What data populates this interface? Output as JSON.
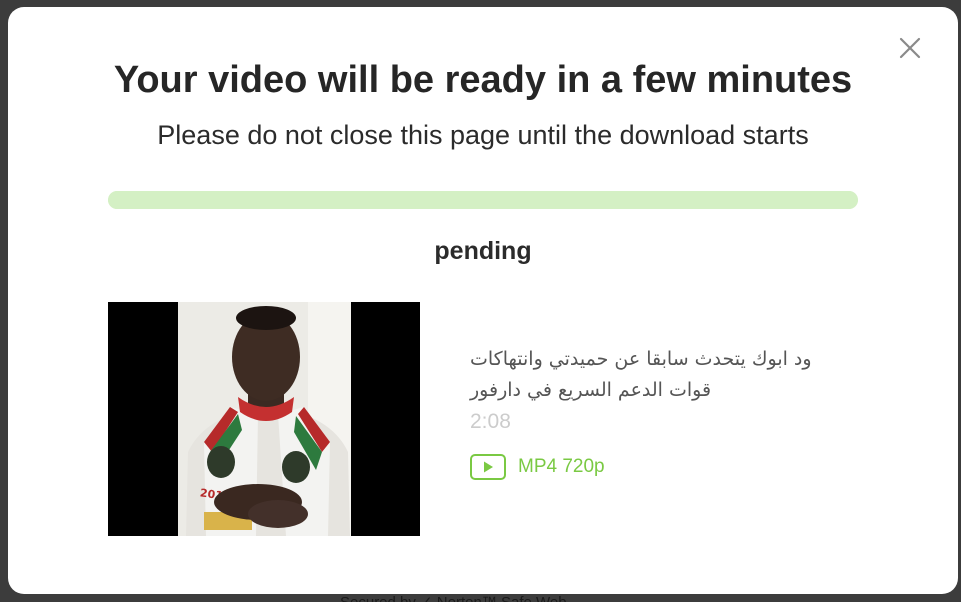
{
  "modal": {
    "title": "Your video will be ready in a few minutes",
    "subtitle": "Please do not close this page until the download starts",
    "progress": 1.0,
    "progress_color": "#d4f0c4",
    "status": "pending",
    "close_icon": "close-icon"
  },
  "video": {
    "title": "ود ابوك يتحدث سابقا عن حميدتي وانتهاكات قوات الدعم السريع في دارفور",
    "duration": "2:08",
    "thumbnail": {
      "jersey_text": "2018"
    },
    "format": {
      "icon": "play-icon",
      "label": "MP4 720p",
      "color": "#7ac943"
    }
  },
  "backdrop": {
    "footer_text": "Secured by  ✓ Norton™ Safe Web"
  }
}
